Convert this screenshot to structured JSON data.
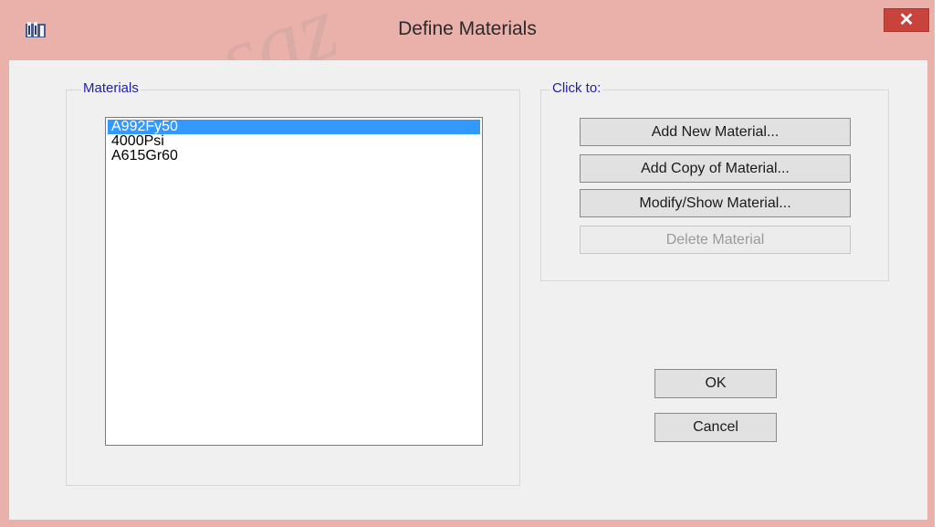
{
  "window": {
    "title": "Define Materials",
    "close_label": "✕"
  },
  "watermark": {
    "text": "saz"
  },
  "materials": {
    "label": "Materials",
    "items": [
      "A992Fy50",
      "4000Psi",
      "A615Gr60"
    ],
    "selected": "A992Fy50"
  },
  "click_to": {
    "label": "Click to:",
    "add_new": "Add New Material...",
    "add_copy": "Add Copy of Material...",
    "modify": "Modify/Show Material...",
    "delete": "Delete Material"
  },
  "buttons": {
    "ok": "OK",
    "cancel": "Cancel"
  },
  "colors": {
    "title_bar": "#e9b1aa",
    "close_button": "#c9433d",
    "selection": "#3399ff",
    "group_label": "#1f1fa5"
  }
}
